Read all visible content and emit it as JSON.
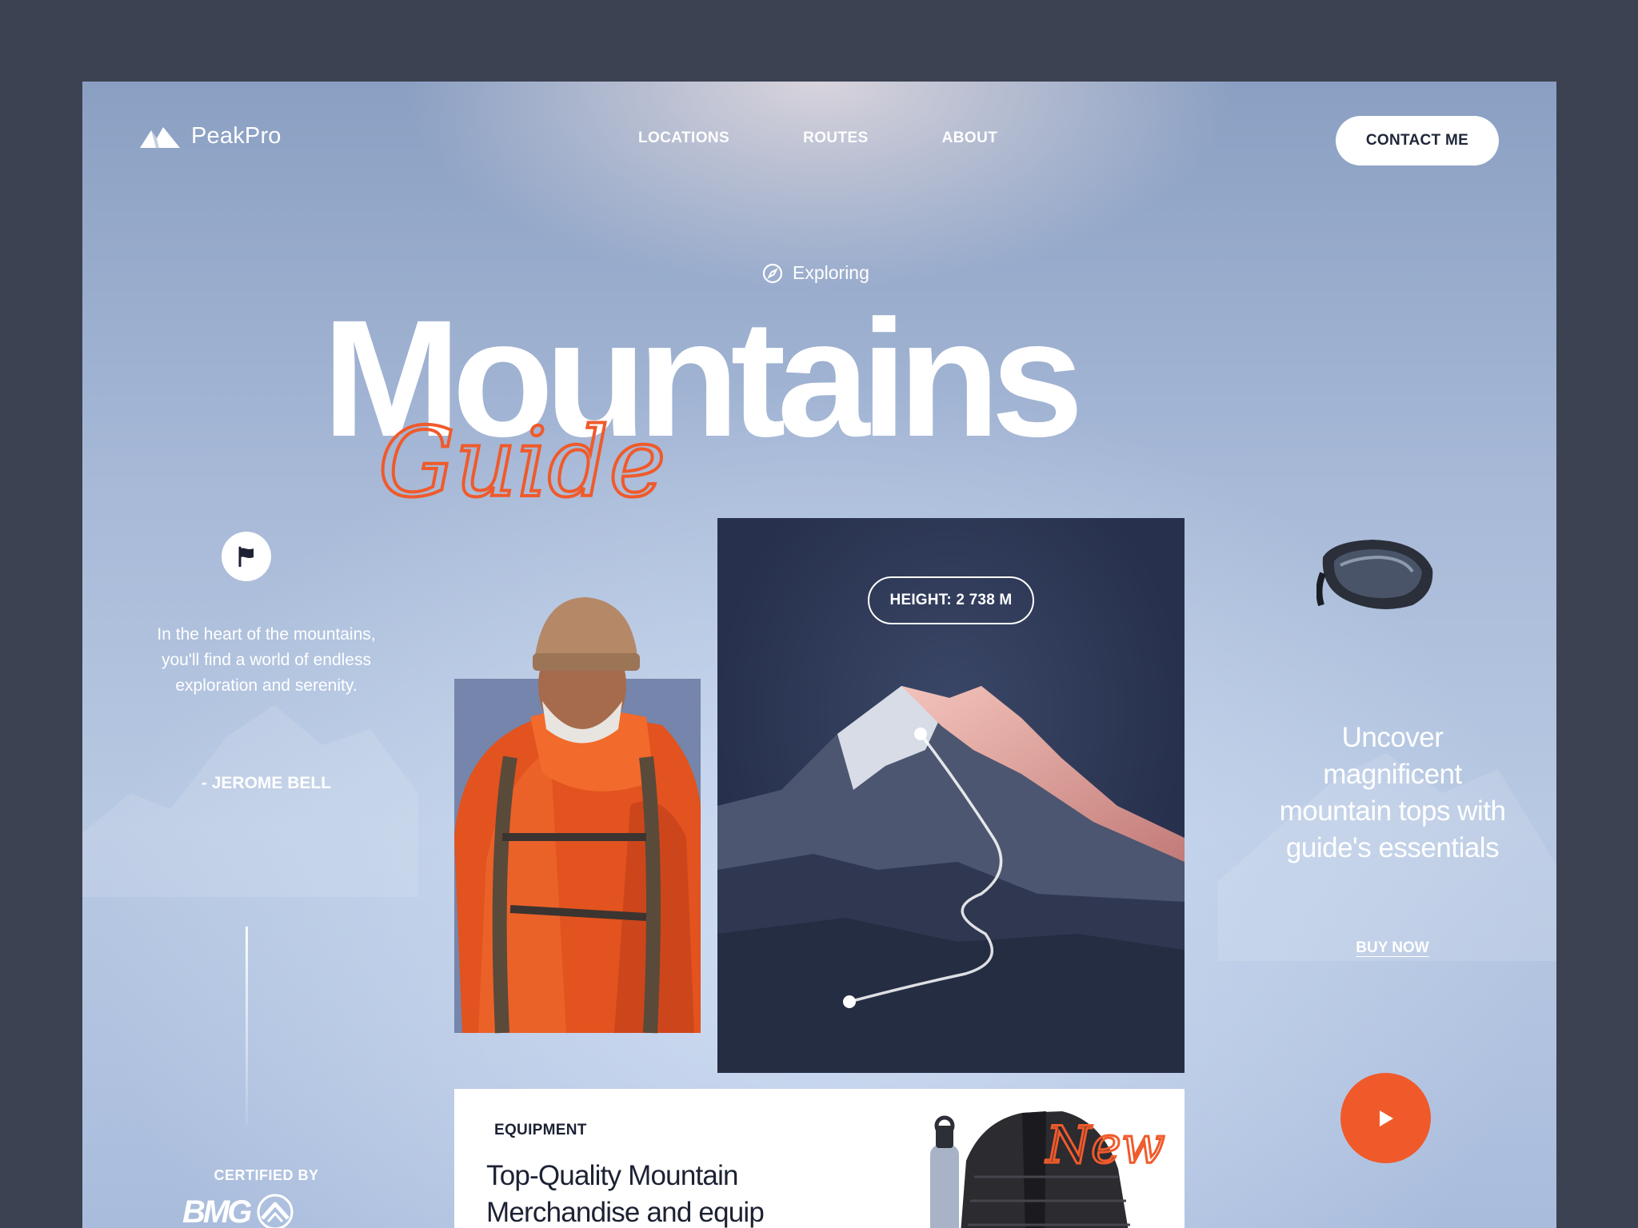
{
  "brand": {
    "name": "PeakPro"
  },
  "nav": {
    "items": [
      "LOCATIONS",
      "ROUTES",
      "ABOUT"
    ]
  },
  "header": {
    "contact_label": "CONTACT ME"
  },
  "hero": {
    "eyebrow": "Exploring",
    "title": "Mountains",
    "script_word": "Guide"
  },
  "quote": {
    "text": "In the heart of the mountains, you'll find a world of endless exploration and serenity.",
    "author": "- JEROME BELL"
  },
  "certification": {
    "label": "CERTIFIED BY",
    "logo_text": "BMG"
  },
  "mountain_card": {
    "height_label": "HEIGHT: 2 738 M"
  },
  "promo": {
    "text": "Uncover magnificent mountain tops with guide's essentials",
    "cta": "BUY NOW"
  },
  "equipment": {
    "label": "EQUIPMENT",
    "title": "Top-Quality Mountain Merchandise and equip",
    "badge_script": "New"
  },
  "colors": {
    "accent": "#f05a2b",
    "dark": "#1c2233",
    "card": "#2a3452"
  },
  "icons": [
    "mountain-logo-icon",
    "compass-icon",
    "flag-icon",
    "play-icon",
    "bmg-mountain-icon"
  ]
}
